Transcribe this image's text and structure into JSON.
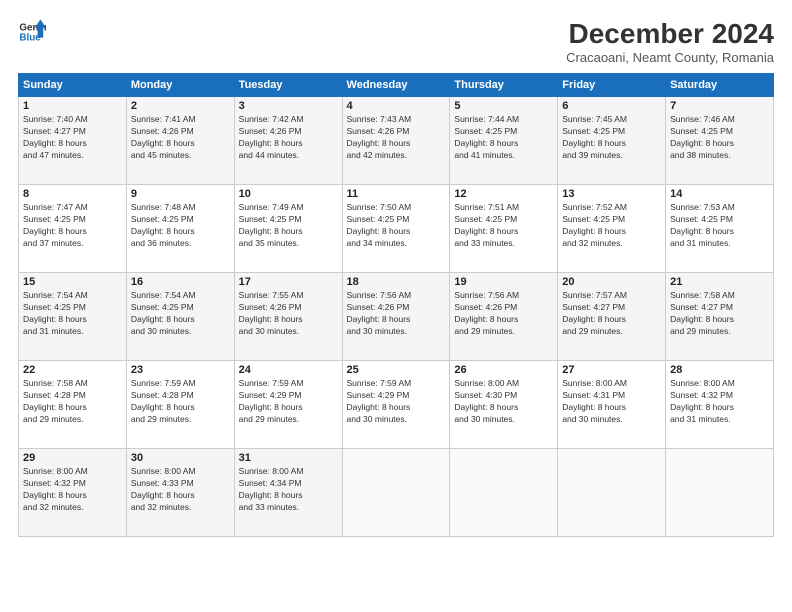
{
  "logo": {
    "line1": "General",
    "line2": "Blue"
  },
  "title": "December 2024",
  "subtitle": "Cracaoani, Neamt County, Romania",
  "weekdays": [
    "Sunday",
    "Monday",
    "Tuesday",
    "Wednesday",
    "Thursday",
    "Friday",
    "Saturday"
  ],
  "weeks": [
    [
      {
        "day": "1",
        "rise": "7:40 AM",
        "set": "4:27 PM",
        "dl_hours": "8",
        "dl_mins": "47"
      },
      {
        "day": "2",
        "rise": "7:41 AM",
        "set": "4:26 PM",
        "dl_hours": "8",
        "dl_mins": "45"
      },
      {
        "day": "3",
        "rise": "7:42 AM",
        "set": "4:26 PM",
        "dl_hours": "8",
        "dl_mins": "44"
      },
      {
        "day": "4",
        "rise": "7:43 AM",
        "set": "4:26 PM",
        "dl_hours": "8",
        "dl_mins": "42"
      },
      {
        "day": "5",
        "rise": "7:44 AM",
        "set": "4:25 PM",
        "dl_hours": "8",
        "dl_mins": "41"
      },
      {
        "day": "6",
        "rise": "7:45 AM",
        "set": "4:25 PM",
        "dl_hours": "8",
        "dl_mins": "39"
      },
      {
        "day": "7",
        "rise": "7:46 AM",
        "set": "4:25 PM",
        "dl_hours": "8",
        "dl_mins": "38"
      }
    ],
    [
      {
        "day": "8",
        "rise": "7:47 AM",
        "set": "4:25 PM",
        "dl_hours": "8",
        "dl_mins": "37"
      },
      {
        "day": "9",
        "rise": "7:48 AM",
        "set": "4:25 PM",
        "dl_hours": "8",
        "dl_mins": "36"
      },
      {
        "day": "10",
        "rise": "7:49 AM",
        "set": "4:25 PM",
        "dl_hours": "8",
        "dl_mins": "35"
      },
      {
        "day": "11",
        "rise": "7:50 AM",
        "set": "4:25 PM",
        "dl_hours": "8",
        "dl_mins": "34"
      },
      {
        "day": "12",
        "rise": "7:51 AM",
        "set": "4:25 PM",
        "dl_hours": "8",
        "dl_mins": "33"
      },
      {
        "day": "13",
        "rise": "7:52 AM",
        "set": "4:25 PM",
        "dl_hours": "8",
        "dl_mins": "32"
      },
      {
        "day": "14",
        "rise": "7:53 AM",
        "set": "4:25 PM",
        "dl_hours": "8",
        "dl_mins": "31"
      }
    ],
    [
      {
        "day": "15",
        "rise": "7:54 AM",
        "set": "4:25 PM",
        "dl_hours": "8",
        "dl_mins": "31"
      },
      {
        "day": "16",
        "rise": "7:54 AM",
        "set": "4:25 PM",
        "dl_hours": "8",
        "dl_mins": "30"
      },
      {
        "day": "17",
        "rise": "7:55 AM",
        "set": "4:26 PM",
        "dl_hours": "8",
        "dl_mins": "30"
      },
      {
        "day": "18",
        "rise": "7:56 AM",
        "set": "4:26 PM",
        "dl_hours": "8",
        "dl_mins": "30"
      },
      {
        "day": "19",
        "rise": "7:56 AM",
        "set": "4:26 PM",
        "dl_hours": "8",
        "dl_mins": "29"
      },
      {
        "day": "20",
        "rise": "7:57 AM",
        "set": "4:27 PM",
        "dl_hours": "8",
        "dl_mins": "29"
      },
      {
        "day": "21",
        "rise": "7:58 AM",
        "set": "4:27 PM",
        "dl_hours": "8",
        "dl_mins": "29"
      }
    ],
    [
      {
        "day": "22",
        "rise": "7:58 AM",
        "set": "4:28 PM",
        "dl_hours": "8",
        "dl_mins": "29"
      },
      {
        "day": "23",
        "rise": "7:59 AM",
        "set": "4:28 PM",
        "dl_hours": "8",
        "dl_mins": "29"
      },
      {
        "day": "24",
        "rise": "7:59 AM",
        "set": "4:29 PM",
        "dl_hours": "8",
        "dl_mins": "29"
      },
      {
        "day": "25",
        "rise": "7:59 AM",
        "set": "4:29 PM",
        "dl_hours": "8",
        "dl_mins": "30"
      },
      {
        "day": "26",
        "rise": "8:00 AM",
        "set": "4:30 PM",
        "dl_hours": "8",
        "dl_mins": "30"
      },
      {
        "day": "27",
        "rise": "8:00 AM",
        "set": "4:31 PM",
        "dl_hours": "8",
        "dl_mins": "30"
      },
      {
        "day": "28",
        "rise": "8:00 AM",
        "set": "4:32 PM",
        "dl_hours": "8",
        "dl_mins": "31"
      }
    ],
    [
      {
        "day": "29",
        "rise": "8:00 AM",
        "set": "4:32 PM",
        "dl_hours": "8",
        "dl_mins": "32"
      },
      {
        "day": "30",
        "rise": "8:00 AM",
        "set": "4:33 PM",
        "dl_hours": "8",
        "dl_mins": "32"
      },
      {
        "day": "31",
        "rise": "8:00 AM",
        "set": "4:34 PM",
        "dl_hours": "8",
        "dl_mins": "33"
      },
      null,
      null,
      null,
      null
    ]
  ],
  "labels": {
    "sunrise": "Sunrise:",
    "sunset": "Sunset:",
    "daylight": "Daylight:",
    "hours_suffix": "hours",
    "and": "and",
    "minutes_suffix": "minutes."
  }
}
